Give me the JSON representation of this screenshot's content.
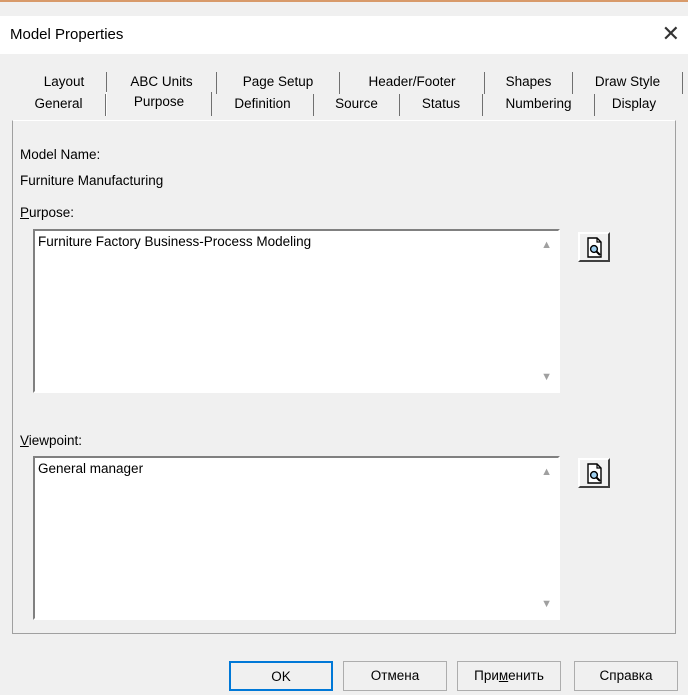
{
  "window": {
    "title": "Model Properties",
    "close_glyph": "✕"
  },
  "tabs": {
    "row1": [
      "Layout",
      "ABC Units",
      "Page Setup",
      "Header/Footer",
      "Shapes",
      "Draw Style"
    ],
    "row2": [
      "General",
      "Purpose",
      "Definition",
      "Source",
      "Status",
      "Numbering",
      "Display"
    ],
    "active": "Purpose"
  },
  "model": {
    "name_label": "Model Name:",
    "name_value": "Furniture Manufacturing"
  },
  "purpose": {
    "label_underlined": "P",
    "label_rest": "urpose:",
    "value": "Furniture Factory Business-Process Modeling"
  },
  "viewpoint": {
    "label_underlined": "V",
    "label_rest": "iewpoint:",
    "value": "General manager"
  },
  "buttons": {
    "ok": "OK",
    "cancel": "Отмена",
    "apply_pre": "При",
    "apply_u": "м",
    "apply_post": "енить",
    "help": "Справка"
  },
  "icons": {
    "browse": "magnifier-document-icon",
    "scroll_up": "▲",
    "scroll_down": "▼"
  }
}
